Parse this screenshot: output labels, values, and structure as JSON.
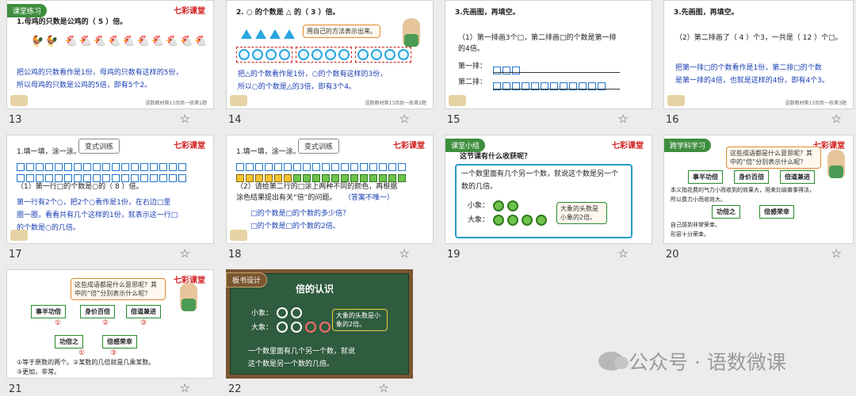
{
  "slides": [
    {
      "num": "13",
      "tag": "课堂练习",
      "logo": "七彩课堂",
      "title": "1.母鸡的只数是公鸡的（ 5 ）倍。",
      "hens": "🐓🐓 🐔🐔🐔🐔🐔🐔🐔🐔🐔🐔",
      "text1": "把公鸡的只数看作是1份，母鸡的只数有这样的5份，",
      "text2": "所以母鸡的只数是公鸡的5倍，即有5个2。",
      "foot": "语数教材第13页练一练第1题"
    },
    {
      "num": "14",
      "title": "2. ○ 的个数是 △ 的（ 3 ）倍。",
      "bubble": "用自己的方法表示出来。",
      "text1": "把△的个数看作是1份，○的个数有这样的3份，",
      "text2": "所以○的个数是△的3倍，即有3个4。",
      "foot": "语数教材第13页练一练第2题"
    },
    {
      "num": "15",
      "title": "3.先画图，再填空。",
      "q": "（1）第一排画3个□，第二排画□的个数是第一排",
      "q2": "的4倍。",
      "row1": "第一排：",
      "row2": "第二排："
    },
    {
      "num": "16",
      "title": "3.先画图，再填空。",
      "q": "（2）第二排画了（ 4 ）个3，一共是（ 12 ）个□。",
      "text1": "把第一排□的个数看作是1份，第二排□的个数",
      "text2": "是第一排的4倍，也就是这样的4份，即有4个3。",
      "foot": "语数教材第13页练一练第3题"
    },
    {
      "num": "17",
      "tag": "变式训练",
      "logo": "七彩课堂",
      "title": "1.填一填，涂一涂。",
      "q": "（1）第一行□的个数是○的（ 8 ）倍。",
      "text1": "第一行有2个○，把2个○看作是1份，在右边□里",
      "text2": "圈一圈，看看共有几个这样的1份，就表示这一行□",
      "text3": "的个数是○的几倍。"
    },
    {
      "num": "18",
      "tag": "变式训练",
      "logo": "七彩课堂",
      "title": "1.填一填，涂一涂。",
      "q": "（2）请给第二行的□涂上两种不同的颜色，再根据",
      "q2": "涂色结果提出有关“倍”的问题。",
      "ans": "（答案不唯一）",
      "text1": "□的个数是□的个数的多少倍？",
      "text2": "□的个数是□的个数的2倍。"
    },
    {
      "num": "19",
      "tag": "课堂小结",
      "logo": "七彩课堂",
      "title": "这节课有什么收获呢？",
      "text1": "一个数里面有几个另一个数，就说这个数是另一个",
      "text2": "数的几倍。",
      "small": "小象：",
      "big": "大象：",
      "bubble": "大象的头数是小象的2倍。"
    },
    {
      "num": "20",
      "tag": "跨学科学习",
      "logo": "七彩课堂",
      "title": "这些成语都是什么意思呢？其中的“倍”分别表示什么呢？",
      "c1": "事半功倍",
      "c2": "身价百倍",
      "c3": "倍道兼进",
      "c4": "功倍之",
      "c5": "倍感荣幸",
      "p1": "本义指花费的气力小而收到的效果大，用来比喻做事得法，",
      "p2": "所以费力小而收效大。",
      "p3": "自己感到非常荣幸。",
      "p4": "形容十分荣幸。"
    },
    {
      "num": "21",
      "logo": "七彩课堂",
      "title": "这些成语都是什么意思呢？其中的“倍”分别表示什么呢？",
      "c1": "事半功倍",
      "c2": "身价百倍",
      "c3": "倍道兼进",
      "c4": "功倍之",
      "c5": "倍感荣幸",
      "m1": "①",
      "m2": "②",
      "m3": "③",
      "m4": "①",
      "m5": "③",
      "note1": "①等于原数的两个。②某数的几倍就是几乘某数。",
      "note2": "③更加，非常。"
    },
    {
      "num": "22",
      "tag": "板书设计",
      "title": "倍的认识",
      "small": "小象：",
      "big": "大象：",
      "bubble": "大象的头数是小象的2倍。",
      "text1": "一个数里面有几个另一个数，就说",
      "text2": "这个数是另一个数的几倍。"
    }
  ],
  "watermark": "公众号 · 语数微课",
  "icons": {
    "favorite": "star-outline-icon",
    "logo": "wechat-icon"
  }
}
